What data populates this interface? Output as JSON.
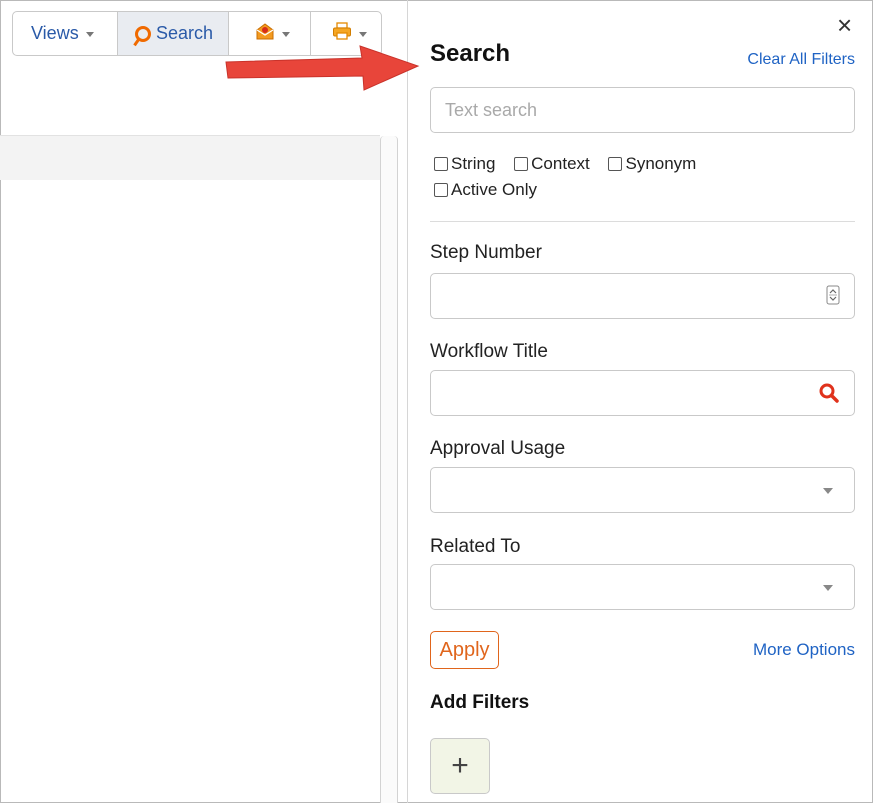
{
  "toolbar": {
    "views_label": "Views",
    "search_label": "Search"
  },
  "panel": {
    "title": "Search",
    "clear_all": "Clear All Filters",
    "close": "×",
    "text_search_placeholder": "Text search",
    "checkboxes": {
      "string": "String",
      "context": "Context",
      "synonym": "Synonym",
      "active_only": "Active Only"
    },
    "fields": {
      "step_number": "Step Number",
      "workflow_title": "Workflow Title",
      "approval_usage": "Approval Usage",
      "related_to": "Related To"
    },
    "apply": "Apply",
    "more_options": "More Options",
    "add_filters": "Add Filters",
    "add_button": "+"
  },
  "colors": {
    "accent_orange": "#e0651c",
    "link_blue": "#1f63c4",
    "arrow_red": "#e8453a"
  }
}
